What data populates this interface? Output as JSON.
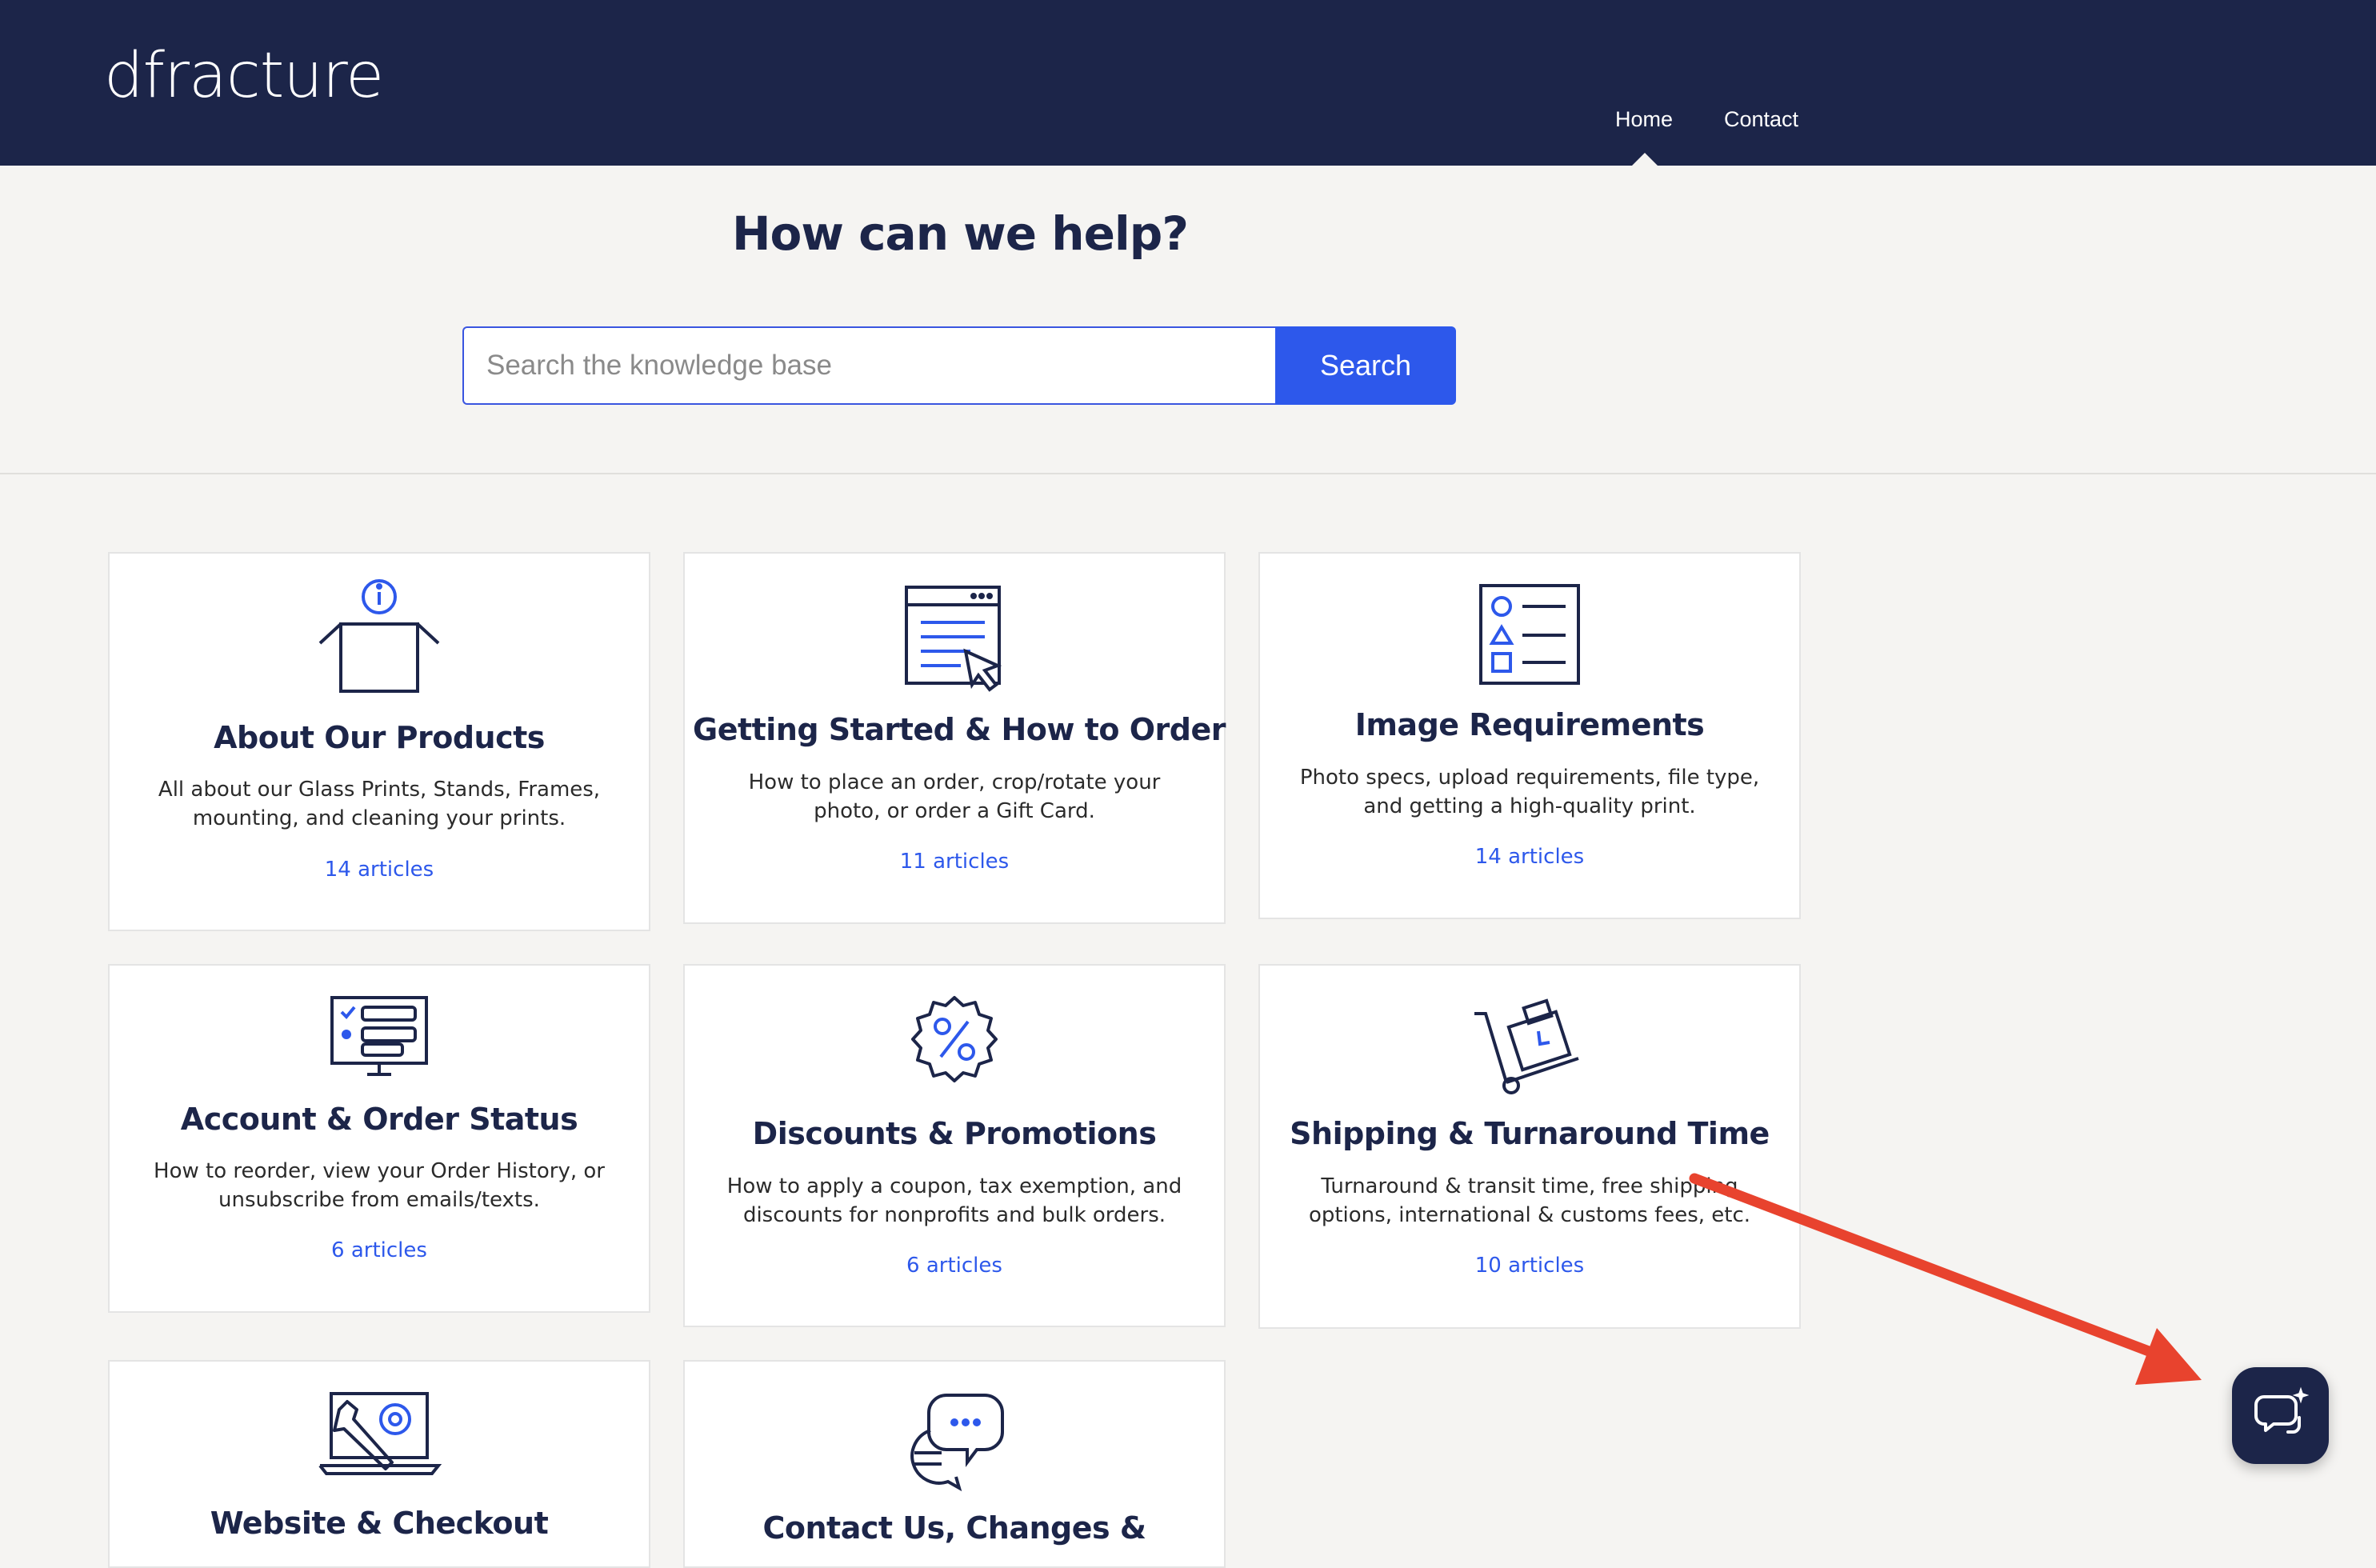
{
  "header": {
    "logo_text": "dfracture",
    "nav": {
      "home": "Home",
      "contact": "Contact"
    }
  },
  "hero": {
    "title": "How can we help?",
    "search_placeholder": "Search the knowledge base",
    "search_button": "Search"
  },
  "categories": [
    {
      "title": "About Our Products",
      "description": "All about our Glass Prints, Stands, Frames, mounting, and cleaning your prints.",
      "count": "14 articles",
      "icon": "box-info-icon"
    },
    {
      "title": "Getting Started & How to Order",
      "description": "How to place an order, crop/rotate your photo, or order a Gift Card.",
      "count": "11 articles",
      "icon": "browser-cursor-icon"
    },
    {
      "title": "Image Requirements",
      "description": "Photo specs, upload requirements, file type, and getting a high-quality print.",
      "count": "14 articles",
      "icon": "shapes-checklist-icon"
    },
    {
      "title": "Account & Order Status",
      "description": "How to reorder, view your Order History, or unsubscribe from emails/texts.",
      "count": "6 articles",
      "icon": "monitor-checklist-icon"
    },
    {
      "title": "Discounts & Promotions",
      "description": "How to apply a coupon, tax exemption, and discounts for nonprofits and bulk orders.",
      "count": "6 articles",
      "icon": "percent-badge-icon"
    },
    {
      "title": "Shipping & Turnaround Time",
      "description": "Turnaround & transit time, free shipping options, international & customs fees, etc.",
      "count": "10 articles",
      "icon": "hand-truck-clock-icon"
    },
    {
      "title": "Website & Checkout",
      "icon": "laptop-wrench-gear-icon"
    },
    {
      "title": "Contact Us, Changes &",
      "icon": "chat-bubbles-icon"
    }
  ],
  "chat_widget": {
    "icon": "chat-sparkle-icon"
  },
  "colors": {
    "navy": "#1c2549",
    "accent_blue": "#2d58eb",
    "arrow_red": "#e8432e"
  }
}
